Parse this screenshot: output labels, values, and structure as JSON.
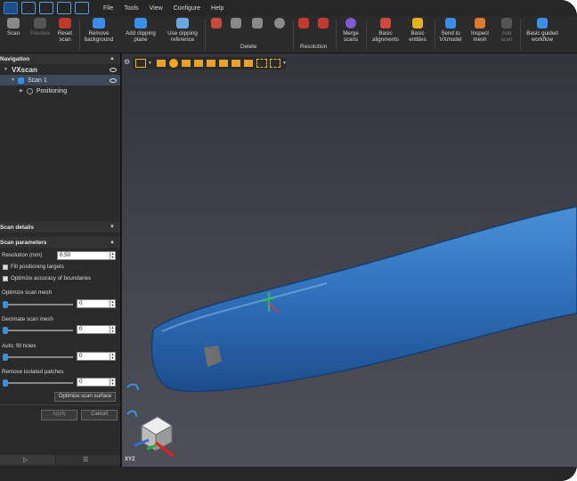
{
  "menu": [
    "File",
    "Tools",
    "View",
    "Configure",
    "Help"
  ],
  "toolbar": {
    "scan": "Scan",
    "preview": "Preview",
    "reset_scan": "Reset\nscan",
    "remove_background": "Remove\nbackground",
    "add_clipping_plane": "Add clipping\nplane",
    "use_clipping_reference": "Use clipping\nreference",
    "delete_group": "Delete",
    "resolution_group": "Resolution",
    "merge_scans": "Merge\nscans",
    "basic_alignments": "Basic\nalignments",
    "basic_entities": "Basic\nentities",
    "send_to_vxmodel": "Send to\nVXmodel",
    "inspect_mesh": "Inspect\nmesh",
    "add_scan": "Add\nscan",
    "basic_guided_workflow": "Basic guided\nworkflow"
  },
  "navigation": {
    "title": "Navigation",
    "tree": {
      "root": "VXscan",
      "scan": "Scan 1",
      "positioning": "Positioning"
    }
  },
  "scan_details": {
    "title": "Scan details"
  },
  "scan_parameters": {
    "title": "Scan parameters",
    "resolution_label": "Resolution (mm)",
    "resolution_value": "0.50",
    "fill_positioning_targets": "Fill positioning targets",
    "optimize_accuracy": "Optimize accuracy of boundaries",
    "optimize_mesh_label": "Optimize scan mesh",
    "optimize_mesh_value": "0",
    "decimate_label": "Decimate scan mesh",
    "decimate_value": "0",
    "fill_holes_label": "Auto. fill holes",
    "fill_holes_value": "0",
    "remove_patches_label": "Remove isolated patches",
    "remove_patches_value": "0",
    "optimize_surface_button": "Optimize scan surface",
    "apply_button": "Apply",
    "cancel_button": "Cancel"
  },
  "viewport": {
    "axis_labels": "XYZ"
  }
}
